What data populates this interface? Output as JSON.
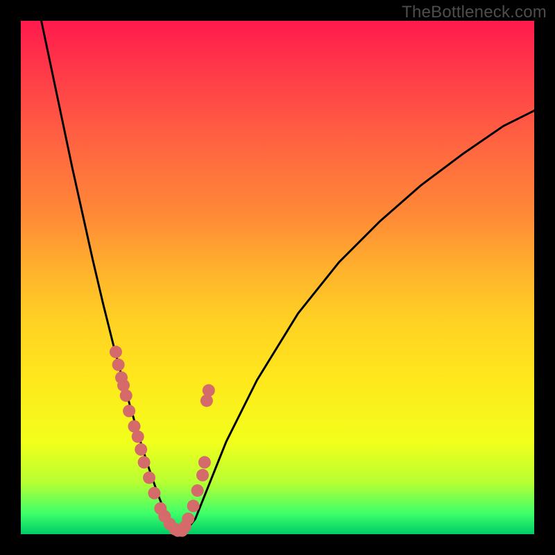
{
  "watermark": "TheBottleneck.com",
  "chart_data": {
    "type": "line",
    "title": "",
    "xlabel": "",
    "ylabel": "",
    "xlim": [
      0,
      100
    ],
    "ylim": [
      0,
      100
    ],
    "grid": false,
    "legend": false,
    "series": [
      {
        "name": "curve",
        "color": "#000000",
        "x": [
          4,
          6,
          8,
          10,
          12,
          14,
          16,
          18,
          20,
          22,
          23,
          24,
          25,
          26,
          27,
          28,
          29,
          30,
          31,
          32,
          34,
          36,
          40,
          46,
          54,
          62,
          70,
          78,
          86,
          94,
          100
        ],
        "y": [
          100,
          90.5,
          81,
          71.5,
          62.5,
          53.5,
          45,
          37,
          29.5,
          22.5,
          19,
          15.8,
          12.7,
          9.8,
          7.0,
          4.5,
          2.5,
          1.0,
          0.2,
          0.5,
          3.0,
          8.0,
          18,
          30,
          43,
          53,
          61,
          68,
          74,
          79.5,
          82.5
        ]
      }
    ],
    "markers": {
      "name": "points",
      "color": "#d46a6a",
      "radius_px": 9,
      "x": [
        18.5,
        19,
        19.6,
        20,
        20.5,
        21.1,
        22.1,
        22.8,
        23.4,
        24.0,
        25.0,
        26.0,
        27.2,
        28.0,
        29.0,
        30.0,
        30.6,
        31.4,
        32.0,
        32.6,
        33.6,
        34.4,
        35.4,
        35.8,
        36.2,
        36.6
      ],
      "y": [
        35.5,
        33.0,
        30.5,
        29.0,
        27.0,
        24.0,
        21.0,
        19.0,
        16.5,
        14.0,
        11.0,
        8.0,
        5.0,
        3.5,
        2.0,
        1.0,
        0.7,
        0.7,
        1.5,
        3.0,
        5.5,
        8.5,
        11.5,
        14.0,
        26.0,
        28.0
      ]
    },
    "background_gradient_stops": [
      {
        "pct": 0,
        "color": "#ff1a4d"
      },
      {
        "pct": 14,
        "color": "#ff4747"
      },
      {
        "pct": 38,
        "color": "#ff8a37"
      },
      {
        "pct": 58,
        "color": "#ffd024"
      },
      {
        "pct": 82,
        "color": "#f2ff1b"
      },
      {
        "pct": 96,
        "color": "#3dff6a"
      },
      {
        "pct": 100,
        "color": "#00cc66"
      }
    ]
  }
}
